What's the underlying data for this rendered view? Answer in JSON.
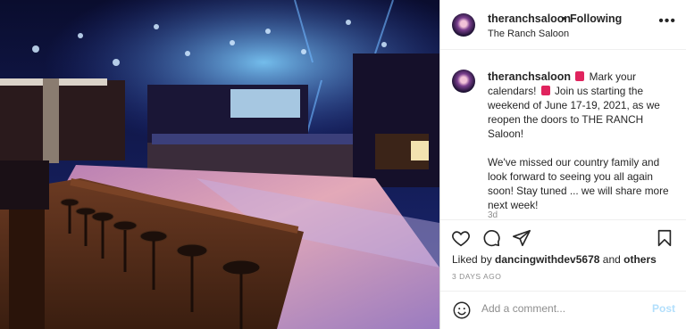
{
  "header": {
    "username": "theranchsaloon",
    "separator": "•",
    "follow_status": "Following",
    "location": "The Ranch Saloon",
    "more_icon": "more-horizontal-icon"
  },
  "caption": {
    "username": "theranchsaloon",
    "part1": "Mark your calendars!",
    "part2": "Join us starting the weekend of June 17-19, 2021, as we reopen the doors to THE RANCH Saloon!",
    "paragraph2": "We've missed our country family and look forward to seeing you all again soon! Stay tuned ... we will share more next week!",
    "time_short": "3d"
  },
  "actions": {
    "like_icon": "heart-icon",
    "comment_icon": "comment-icon",
    "share_icon": "send-icon",
    "save_icon": "bookmark-icon"
  },
  "likes": {
    "prefix": "Liked by",
    "user": "dancingwithdev5678",
    "and": "and",
    "others": "others"
  },
  "posted_ago": "3 DAYS AGO",
  "comment": {
    "placeholder": "Add a comment...",
    "post_label": "Post"
  },
  "colors": {
    "link_disabled": "#b2dffc",
    "muted": "#8e8e8e",
    "text": "#262626"
  }
}
